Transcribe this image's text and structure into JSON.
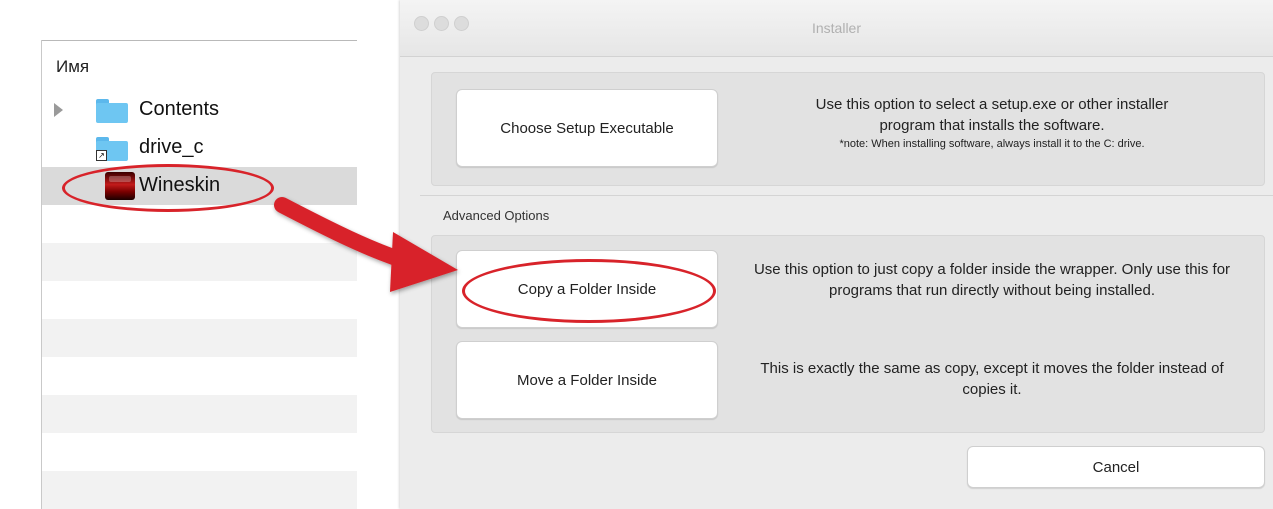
{
  "finder": {
    "column_header": "Имя",
    "items": [
      {
        "label": "Contents"
      },
      {
        "label": "drive_c"
      },
      {
        "label": "Wineskin"
      }
    ]
  },
  "installer": {
    "window_title": "Installer",
    "choose_setup": {
      "button": "Choose Setup Executable",
      "description": "Use this option to select a setup.exe or other installer program that installs the software.",
      "note": "*note: When installing software, always install it to the C: drive."
    },
    "advanced_label": "Advanced Options",
    "copy_folder": {
      "button": "Copy a Folder Inside",
      "description": "Use this option to just copy a folder inside the wrapper. Only use this for programs that run directly without being installed."
    },
    "move_folder": {
      "button": "Move a Folder Inside",
      "description": "This is exactly the same as copy, except it moves the folder instead of copies it."
    },
    "cancel_button": "Cancel"
  },
  "colors": {
    "annotation_red": "#d8232a",
    "folder_blue": "#6ec6f2"
  }
}
